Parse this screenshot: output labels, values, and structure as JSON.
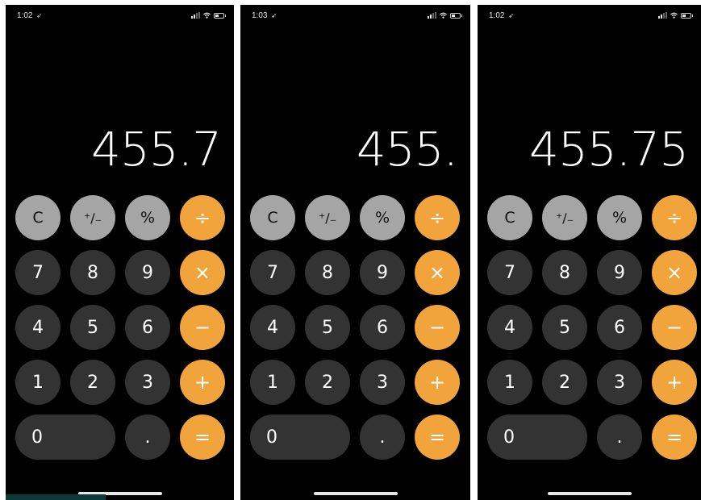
{
  "screens": [
    {
      "time": "1:02",
      "display": "455.7",
      "keys": {
        "clear": "C",
        "negate": "⁺∕₋",
        "percent": "%",
        "divide": "÷",
        "seven": "7",
        "eight": "8",
        "nine": "9",
        "multiply": "×",
        "four": "4",
        "five": "5",
        "six": "6",
        "minus": "−",
        "one": "1",
        "two": "2",
        "three": "3",
        "plus": "+",
        "zero": "0",
        "decimal": ".",
        "equals": "="
      }
    },
    {
      "time": "1:03",
      "display": "455.",
      "keys": {
        "clear": "C",
        "negate": "⁺∕₋",
        "percent": "%",
        "divide": "÷",
        "seven": "7",
        "eight": "8",
        "nine": "9",
        "multiply": "×",
        "four": "4",
        "five": "5",
        "six": "6",
        "minus": "−",
        "one": "1",
        "two": "2",
        "three": "3",
        "plus": "+",
        "zero": "0",
        "decimal": ".",
        "equals": "="
      }
    },
    {
      "time": "1:02",
      "display": "455.75",
      "keys": {
        "clear": "C",
        "negate": "⁺∕₋",
        "percent": "%",
        "divide": "÷",
        "seven": "7",
        "eight": "8",
        "nine": "9",
        "multiply": "×",
        "four": "4",
        "five": "5",
        "six": "6",
        "minus": "−",
        "one": "1",
        "two": "2",
        "three": "3",
        "plus": "+",
        "zero": "0",
        "decimal": ".",
        "equals": "="
      }
    }
  ],
  "colors": {
    "background": "#000000",
    "digit_key": "#333333",
    "function_key": "#a5a5a5",
    "operator_key": "#f1a33c"
  },
  "icons": [
    "location-arrow-icon",
    "signal-icon",
    "wifi-icon",
    "battery-icon"
  ]
}
